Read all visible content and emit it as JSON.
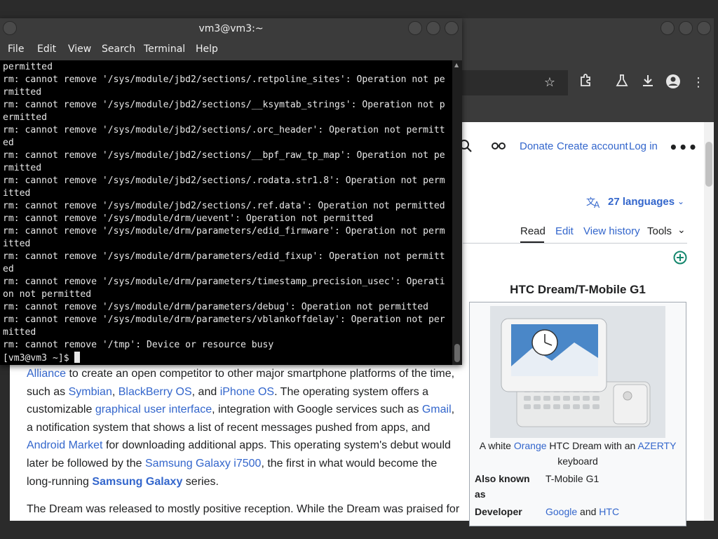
{
  "terminal": {
    "title": "vm3@vm3:~",
    "menu": [
      "File",
      "Edit",
      "View",
      "Search",
      "Terminal",
      "Help"
    ],
    "lines": [
      "permitted",
      "rm: cannot remove '/sys/module/jbd2/sections/.retpoline_sites': Operation not pe",
      "rmitted",
      "rm: cannot remove '/sys/module/jbd2/sections/__ksymtab_strings': Operation not p",
      "ermitted",
      "rm: cannot remove '/sys/module/jbd2/sections/.orc_header': Operation not permitt",
      "ed",
      "rm: cannot remove '/sys/module/jbd2/sections/__bpf_raw_tp_map': Operation not pe",
      "rmitted",
      "rm: cannot remove '/sys/module/jbd2/sections/.rodata.str1.8': Operation not perm",
      "itted",
      "rm: cannot remove '/sys/module/jbd2/sections/.ref.data': Operation not permitted",
      "rm: cannot remove '/sys/module/drm/uevent': Operation not permitted",
      "rm: cannot remove '/sys/module/drm/parameters/edid_firmware': Operation not perm",
      "itted",
      "rm: cannot remove '/sys/module/drm/parameters/edid_fixup': Operation not permitt",
      "ed",
      "rm: cannot remove '/sys/module/drm/parameters/timestamp_precision_usec': Operati",
      "on not permitted",
      "rm: cannot remove '/sys/module/drm/parameters/debug': Operation not permitted",
      "rm: cannot remove '/sys/module/drm/parameters/vblankoffdelay': Operation not per",
      "mitted",
      "rm: cannot remove '/tmp': Device or resource busy"
    ],
    "prompt": "[vm3@vm3 ~]$ "
  },
  "browser": {
    "header_links": {
      "donate": "Donate",
      "create_account": "Create account",
      "log_in": "Log in"
    },
    "languages": "27 languages",
    "tabs": {
      "read": "Read",
      "edit": "Edit",
      "view_history": "View history",
      "tools": "Tools"
    },
    "article": {
      "p1": {
        "alliance": "Alliance",
        "t1": " to create an open competitor to other major smartphone platforms of the time, such as ",
        "symbian": "Symbian",
        "t2": ", ",
        "blackberry": "BlackBerry OS",
        "t3": ", and ",
        "iphone": "iPhone OS",
        "t4": ". The operating system offers a customizable ",
        "gui": "graphical user interface",
        "t5": ", integration with Google services such as ",
        "gmail": "Gmail",
        "t6": ", a notification system that shows a list of recent messages pushed from apps, and ",
        "market": "Android Market",
        "t7": " for downloading additional apps. This operating system's debut would later be followed by the ",
        "galaxy_i7500": "Samsung Galaxy i7500",
        "t8": ", the first in what would become the long-running ",
        "galaxy": "Samsung Galaxy",
        "t9": " series."
      },
      "p2": "The Dream was released to mostly positive reception. While the Dream was praised for"
    },
    "infobox": {
      "title": "HTC Dream/T-Mobile G1",
      "caption_a": "A white ",
      "caption_orange": "Orange",
      "caption_b": " HTC Dream with an ",
      "caption_azerty": "AZERTY",
      "caption_c": " keyboard",
      "aka_label": "Also known as",
      "aka_value": "T-Mobile G1",
      "dev_label": "Developer",
      "dev_google": "Google",
      "dev_and": " and ",
      "dev_htc": "HTC"
    }
  },
  "colors": {
    "link": "#3366cc",
    "terminal_bg": "#000000",
    "titlebar": "#3b3b3b"
  }
}
